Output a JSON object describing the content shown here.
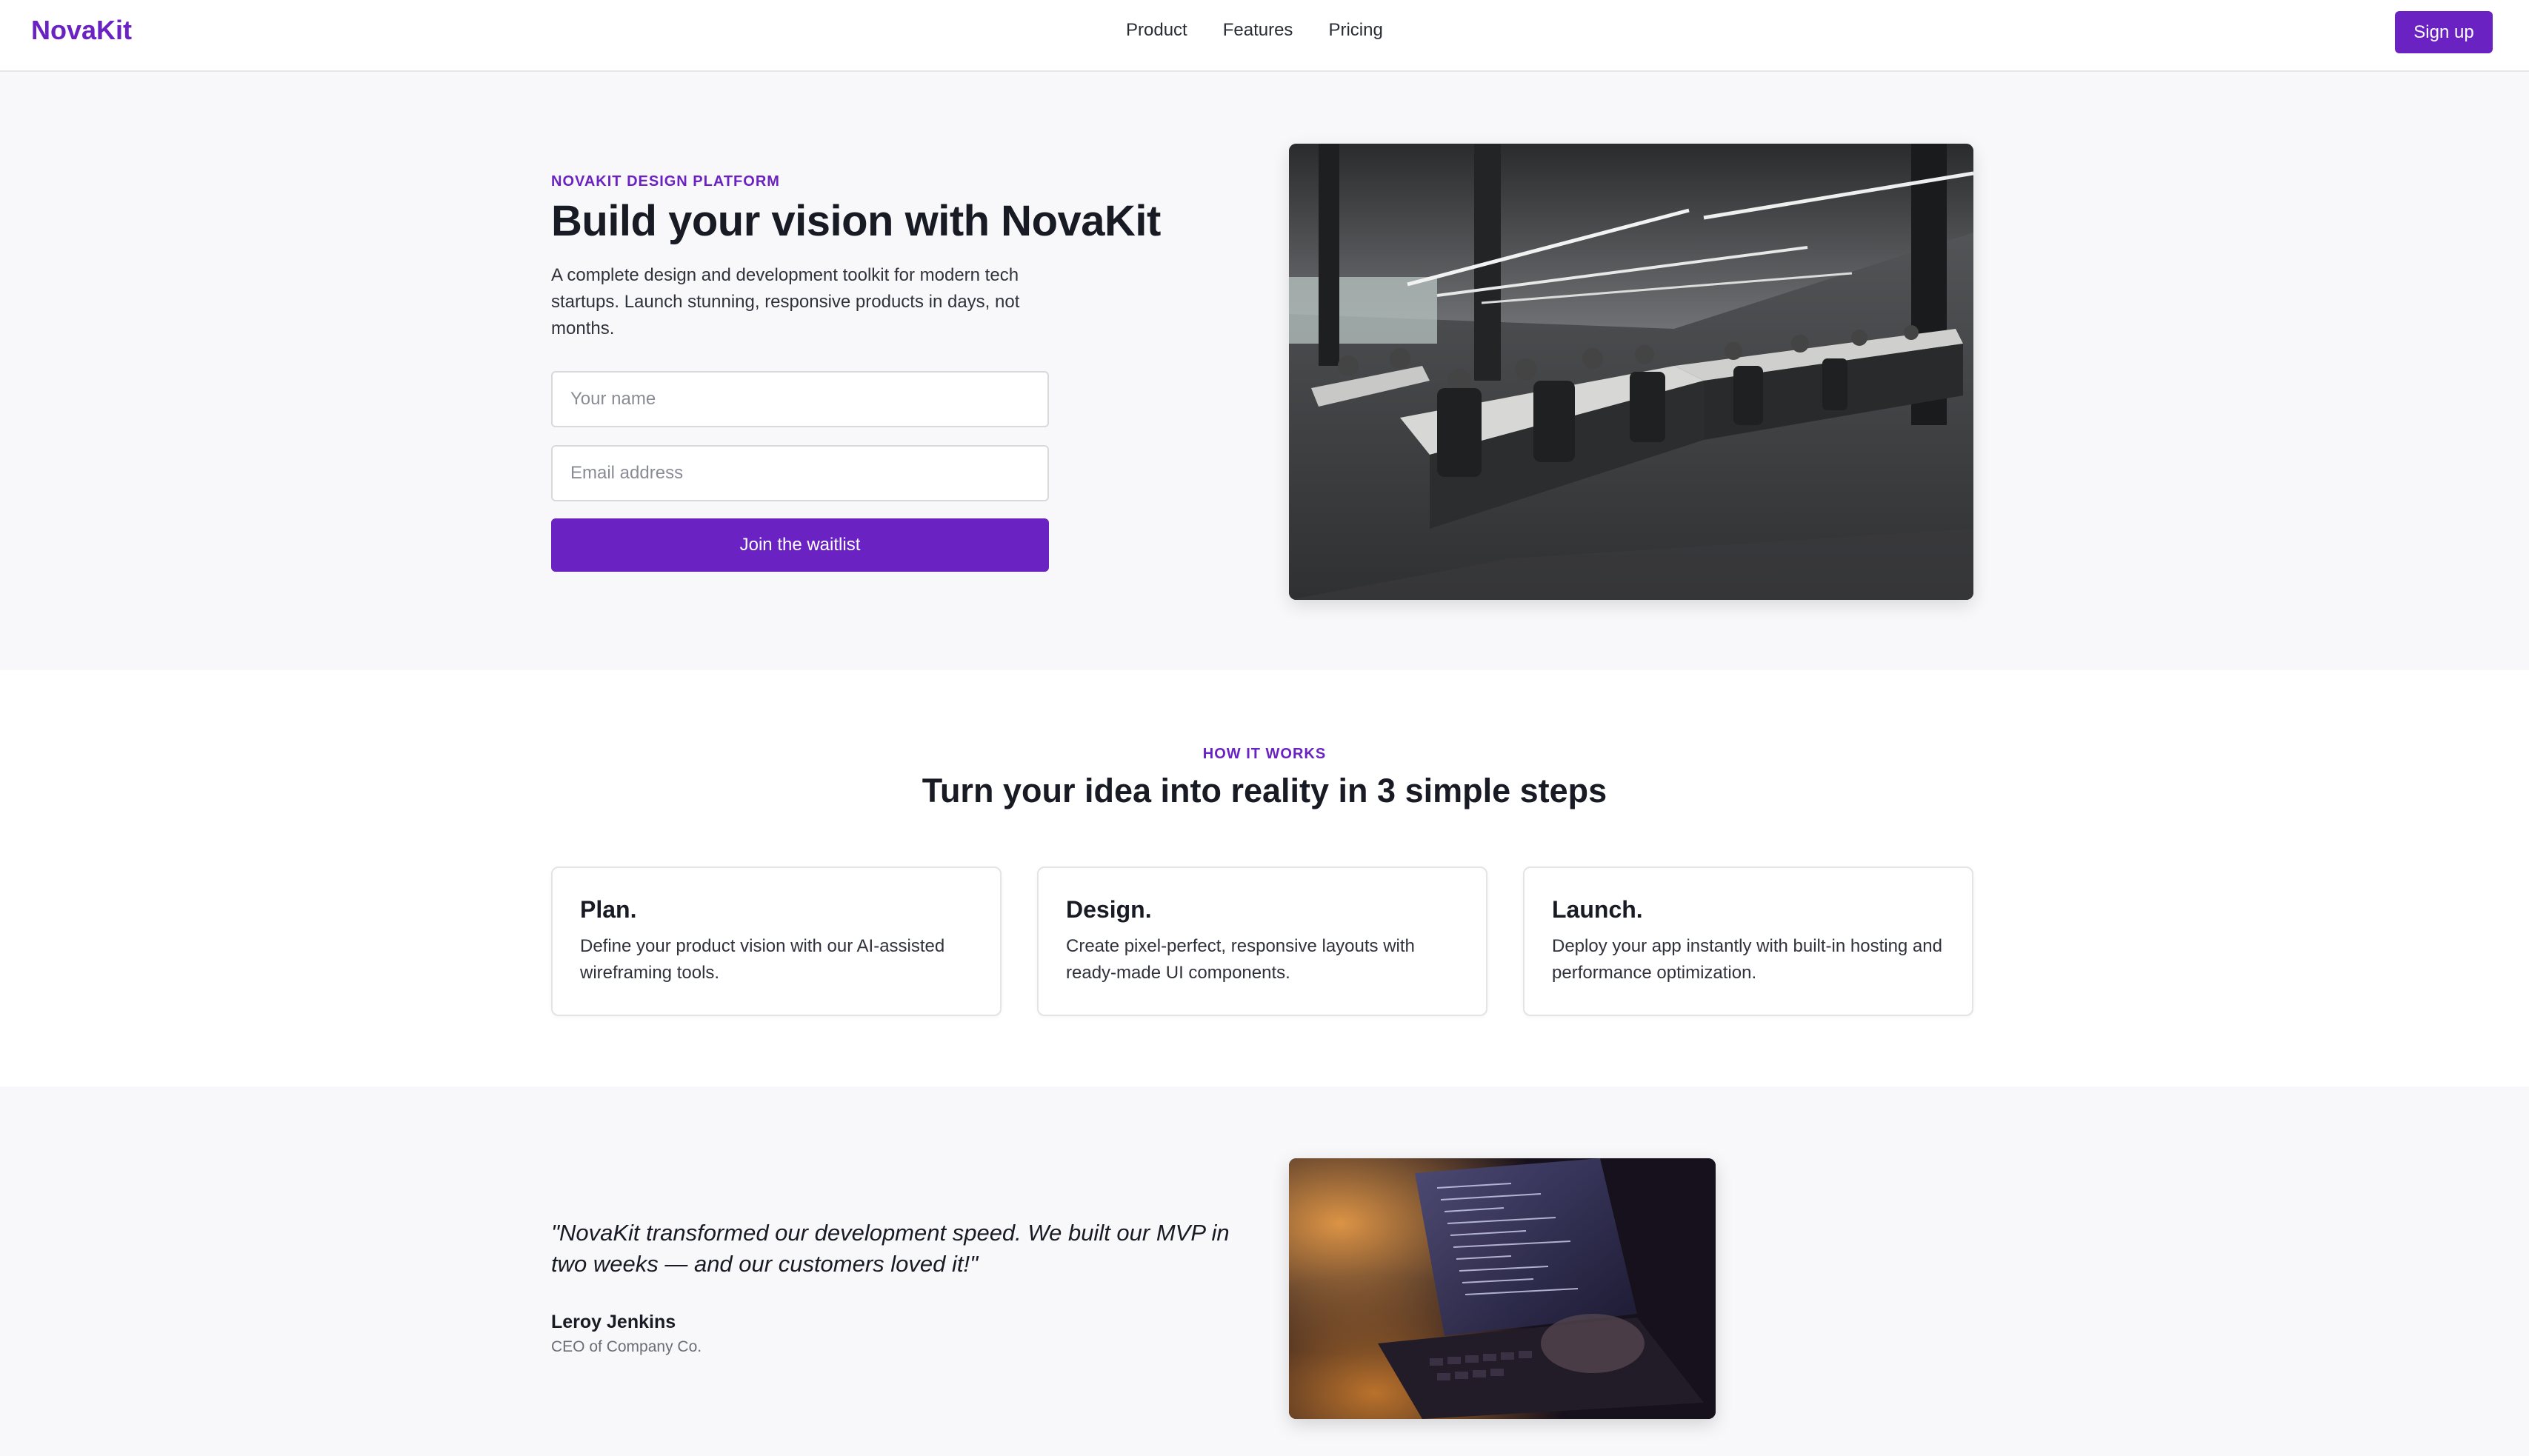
{
  "nav": {
    "brand": "NovaKit",
    "links": [
      "Product",
      "Features",
      "Pricing"
    ],
    "signup_label": "Sign up"
  },
  "hero": {
    "eyebrow": "NOVAKIT DESIGN PLATFORM",
    "title": "Build your vision with NovaKit",
    "description": "A complete design and development toolkit for modern tech startups. Launch stunning, responsive products in days, not months.",
    "name_placeholder": "Your name",
    "email_placeholder": "Email address",
    "cta_label": "Join the waitlist"
  },
  "steps": {
    "eyebrow": "HOW IT WORKS",
    "title": "Turn your idea into reality in 3 simple steps",
    "cards": [
      {
        "title": "Plan.",
        "text": "Define your product vision with our AI-assisted wireframing tools."
      },
      {
        "title": "Design.",
        "text": "Create pixel-perfect, responsive layouts with ready-made UI components."
      },
      {
        "title": "Launch.",
        "text": "Deploy your app instantly with built-in hosting and performance optimization."
      }
    ]
  },
  "testimonial": {
    "quote": "\"NovaKit transformed our development speed. We built our MVP in two weeks — and our customers loved it!\"",
    "author": "Leroy Jenkins",
    "role": "CEO of Company Co."
  },
  "colors": {
    "accent": "#6b22c3",
    "page_background": "#f8f8fa"
  }
}
